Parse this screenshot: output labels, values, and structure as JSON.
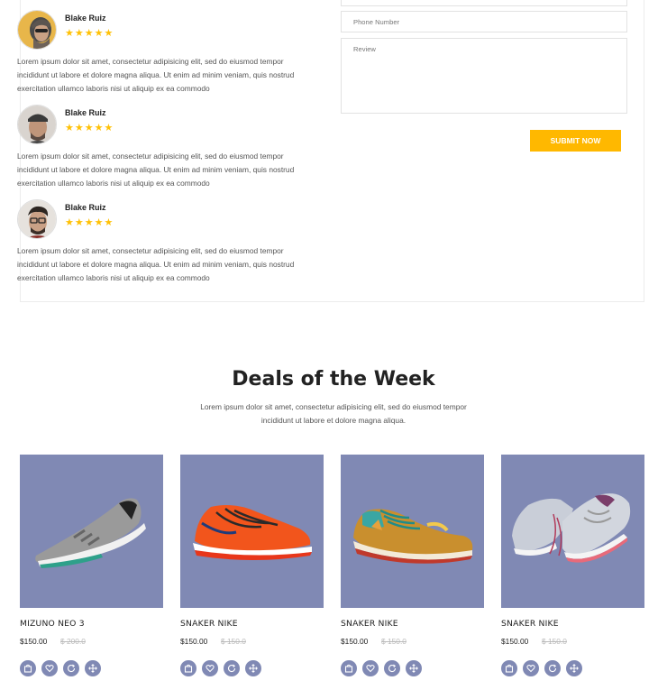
{
  "reviews": [
    {
      "name": "Blake Ruiz",
      "stars": "★★★★★",
      "text": "Lorem ipsum dolor sit amet, consectetur adipisicing elit, sed do eiusmod tempor incididunt ut labore et dolore magna aliqua. Ut enim ad minim veniam, quis nostrud exercitation ullamco laboris nisi ut aliquip ex ea commodo"
    },
    {
      "name": "Blake Ruiz",
      "stars": "★★★★★",
      "text": "Lorem ipsum dolor sit amet, consectetur adipisicing elit, sed do eiusmod tempor incididunt ut labore et dolore magna aliqua. Ut enim ad minim veniam, quis nostrud exercitation ullamco laboris nisi ut aliquip ex ea commodo"
    },
    {
      "name": "Blake Ruiz",
      "stars": "★★★★★",
      "text": "Lorem ipsum dolor sit amet, consectetur adipisicing elit, sed do eiusmod tempor incididunt ut labore et dolore magna aliqua. Ut enim ad minim veniam, quis nostrud exercitation ullamco laboris nisi ut aliquip ex ea commodo"
    }
  ],
  "form": {
    "phone_placeholder": "Phone Number",
    "review_placeholder": "Review",
    "submit_label": "SUBMIT NOW"
  },
  "deals": {
    "title": "Deals of the Week",
    "subtitle": "Lorem ipsum dolor sit amet, consectetur adipisicing elit, sed do eiusmod tempor incididunt ut labore et dolore magna aliqua.",
    "products": [
      {
        "name": "MIZUNO NEO 3",
        "price": "$150.00",
        "old_price": "$ 200.0"
      },
      {
        "name": "SNAKER NIKE",
        "price": "$150.00",
        "old_price": "$ 150.0"
      },
      {
        "name": "SNAKER NIKE",
        "price": "$150.00",
        "old_price": "$ 150.0"
      },
      {
        "name": "SNAKER NIKE",
        "price": "$150.00",
        "old_price": "$ 150.0"
      }
    ]
  },
  "colors": {
    "accent": "#ffb800",
    "product_bg": "#8089b4",
    "star": "#ffc107"
  },
  "icons": [
    "bag-icon",
    "heart-icon",
    "refresh-icon",
    "expand-icon"
  ]
}
